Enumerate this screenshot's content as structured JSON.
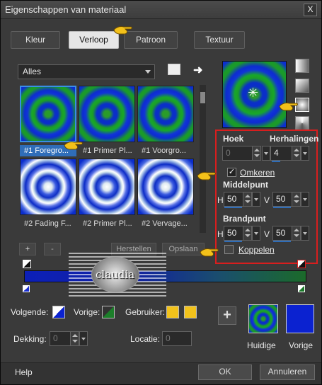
{
  "window": {
    "title": "Eigenschappen van materiaal",
    "close_label": "X"
  },
  "tabs": [
    {
      "label": "Kleur",
      "active": false
    },
    {
      "label": "Verloop",
      "active": true
    },
    {
      "label": "Patroon",
      "active": false
    },
    {
      "label": "Textuur",
      "active": false
    }
  ],
  "category": {
    "selected": "Alles"
  },
  "gradients": [
    {
      "caption": "#1 Foregro...",
      "style": "ring1",
      "selected": true
    },
    {
      "caption": "#1 Primer Pl...",
      "style": "ring1",
      "selected": false
    },
    {
      "caption": "#1 Voorgro...",
      "style": "ring1",
      "selected": false
    },
    {
      "caption": "#2 Fading F...",
      "style": "ring2",
      "selected": false
    },
    {
      "caption": "#2 Primer Pl...",
      "style": "ring2",
      "selected": false
    },
    {
      "caption": "#2 Vervage...",
      "style": "ring2",
      "selected": false
    }
  ],
  "list_buttons": {
    "add": "+",
    "remove": "-",
    "restore": "Herstellen",
    "save": "Opslaan"
  },
  "settings": {
    "angle_label": "Hoek",
    "angle_value": "0",
    "repeats_label": "Herhalingen",
    "repeats_value": "4",
    "invert_label": "Omkeren",
    "invert_checked": true,
    "center_label": "Middelpunt",
    "center_h_label": "H",
    "center_h_value": "50",
    "center_v_label": "V",
    "center_v_value": "50",
    "focal_label": "Brandpunt",
    "focal_h_label": "H",
    "focal_h_value": "50",
    "focal_v_label": "V",
    "focal_v_value": "50",
    "link_label": "Koppelen",
    "link_checked": false
  },
  "watermark": {
    "text": "claudia"
  },
  "colors": {
    "next_label": "Volgende:",
    "prev_label": "Vorige:",
    "user_label": "Gebruiker:",
    "opacity_label": "Dekking:",
    "opacity_value": "0",
    "location_label": "Locatie:",
    "location_value": "0",
    "user_color": "#f2c21b"
  },
  "swatches": {
    "current_label": "Huidige",
    "previous_label": "Vorige",
    "add_label": "+"
  },
  "footer": {
    "help": "Help",
    "ok": "OK",
    "cancel": "Annuleren"
  }
}
